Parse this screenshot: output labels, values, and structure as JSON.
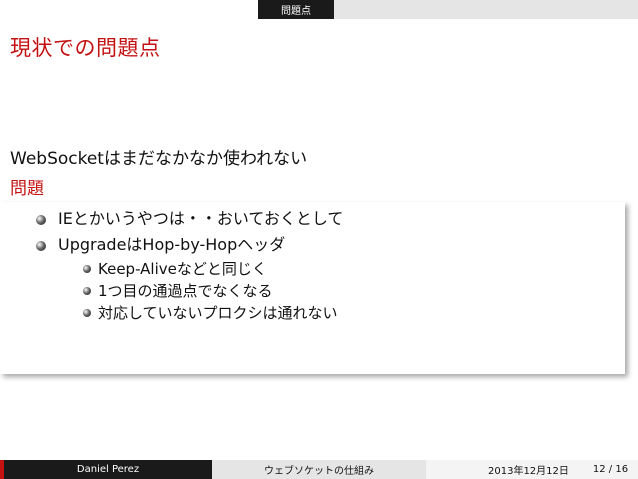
{
  "header": {
    "section": "問題点"
  },
  "frame": {
    "title": "現状での問題点",
    "intro": "WebSocketはまだなかなか使われない",
    "block_title": "問題",
    "items": [
      "IEとかいうやつは・・おいておくとして",
      "UpgradeはHop-by-Hopヘッダ"
    ],
    "subitems": [
      "Keep-Aliveなどと同じく",
      "1つ目の通過点でなくなる",
      "対応していないプロクシは通れない"
    ]
  },
  "footer": {
    "author": "Daniel Perez",
    "talk_title": "ウェブソケットの仕組み",
    "date": "2013年12月12日",
    "page": "12 / 16"
  },
  "colors": {
    "accent": "#c41212",
    "dark": "#1a1a1a",
    "light": "#e5e5e5"
  }
}
